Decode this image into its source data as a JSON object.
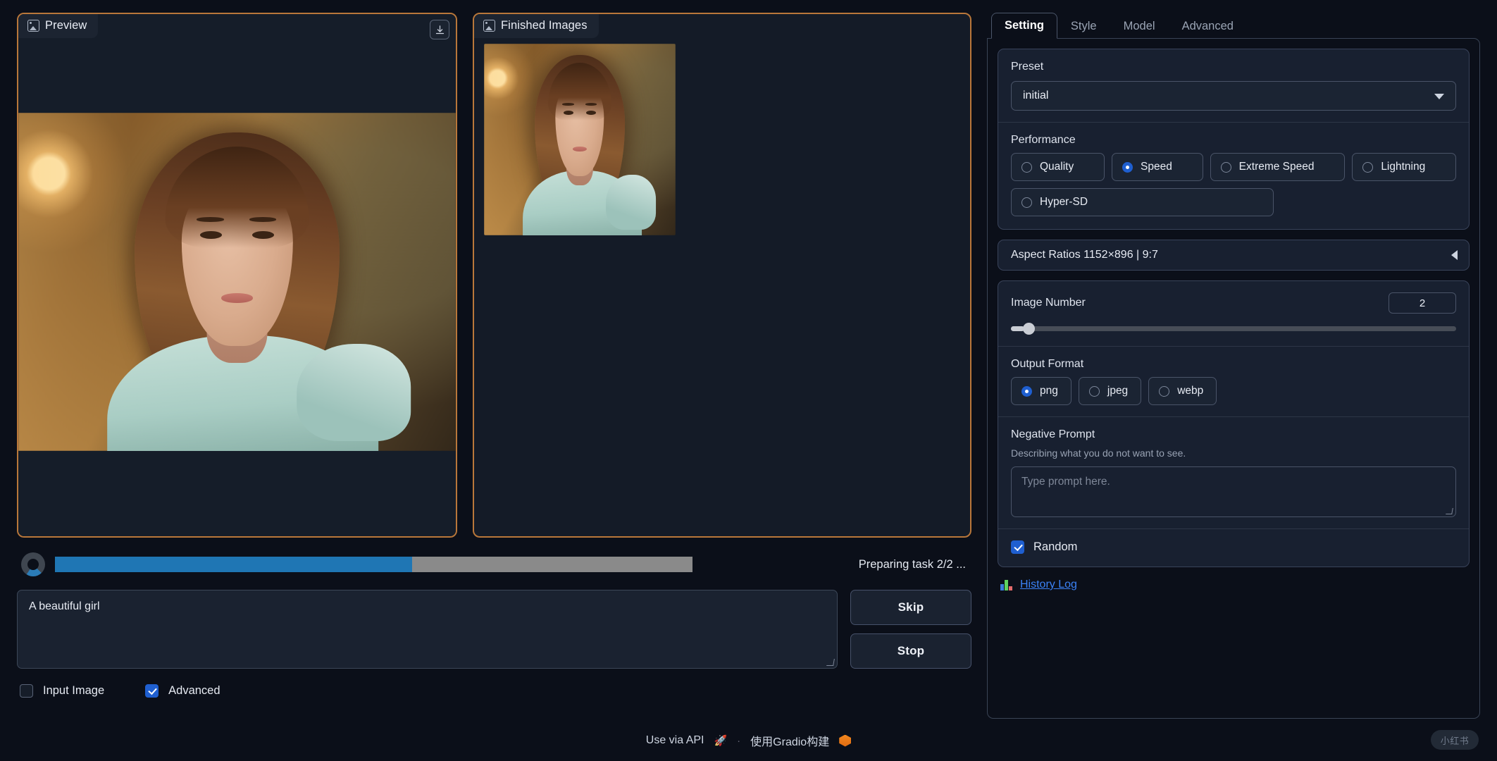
{
  "preview_panel": {
    "tag": "Preview",
    "icon": "image-icon",
    "download_icon": "download-icon"
  },
  "finished_panel": {
    "tag": "Finished Images",
    "icon": "image-icon",
    "thumbnail_count": 1
  },
  "progress": {
    "spinner_icon": "loading-spinner-icon",
    "percent": 56,
    "status_text": "Preparing task 2/2 ..."
  },
  "prompt": {
    "value": "A beautiful girl",
    "placeholder": "Type prompt here."
  },
  "actions": {
    "skip_label": "Skip",
    "stop_label": "Stop"
  },
  "options": {
    "input_image": {
      "label": "Input Image",
      "checked": false
    },
    "advanced": {
      "label": "Advanced",
      "checked": true
    }
  },
  "tabs": [
    {
      "label": "Setting",
      "active": true
    },
    {
      "label": "Style",
      "active": false
    },
    {
      "label": "Model",
      "active": false
    },
    {
      "label": "Advanced",
      "active": false
    }
  ],
  "setting": {
    "preset": {
      "label": "Preset",
      "value": "initial",
      "caret_icon": "chevron-down-icon"
    },
    "performance": {
      "label": "Performance",
      "options": [
        {
          "label": "Quality",
          "selected": false
        },
        {
          "label": "Speed",
          "selected": true
        },
        {
          "label": "Extreme Speed",
          "selected": false
        },
        {
          "label": "Lightning",
          "selected": false
        },
        {
          "label": "Hyper-SD",
          "selected": false
        }
      ]
    },
    "aspect_ratios": {
      "label": "Aspect Ratios 1152×896 | 9:7",
      "caret_icon": "chevron-left-icon",
      "expanded": false
    },
    "image_number": {
      "label": "Image Number",
      "value": "2",
      "slider_percent": 3
    },
    "output_format": {
      "label": "Output Format",
      "options": [
        {
          "label": "png",
          "selected": true
        },
        {
          "label": "jpeg",
          "selected": false
        },
        {
          "label": "webp",
          "selected": false
        }
      ]
    },
    "negative_prompt": {
      "label": "Negative Prompt",
      "hint": "Describing what you do not want to see.",
      "value": "",
      "placeholder": "Type prompt here."
    },
    "random": {
      "label": "Random",
      "checked": true
    },
    "history_log": {
      "label": "History Log",
      "icon": "bar-chart-icon"
    }
  },
  "footer": {
    "api_label": "Use via API",
    "api_icon": "rocket-icon",
    "separator": "·",
    "gradio_label": "使用Gradio构建",
    "gradio_icon": "gradio-logo-icon",
    "watermark": "小红书"
  },
  "colors": {
    "accent_orange": "#b9773a",
    "accent_blue": "#1f5fd0",
    "progress_blue": "#1f76b4",
    "page_bg": "#0b0f19",
    "card_bg": "#182030",
    "link_blue": "#3b82f6"
  }
}
